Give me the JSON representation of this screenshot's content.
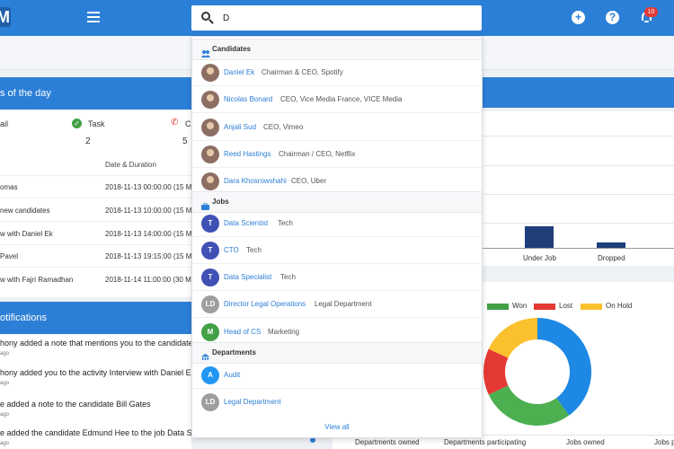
{
  "app": {
    "logo_letter": "M",
    "notifications_count": "10"
  },
  "search": {
    "value": "D",
    "placeholder": ""
  },
  "dropdown": {
    "candidates_heading": "Candidates",
    "candidates": [
      {
        "name": "Daniel Ek",
        "title": "Chairman & CEO, Spotify"
      },
      {
        "name": "Nicolas Bonard",
        "title": "CEO, Vice Media France, VICE Media"
      },
      {
        "name": "Anjali Sud",
        "title": "CEO, Vimeo"
      },
      {
        "name": "Reed Hastings",
        "title": "Chairman / CEO, Netflix"
      },
      {
        "name": "Dara Khosrowshahi",
        "title": "CEO, Uber"
      }
    ],
    "jobs_heading": "Jobs",
    "jobs": [
      {
        "initials": "T",
        "name": "Data Scientist",
        "department": "Tech",
        "color": "#3f51b5"
      },
      {
        "initials": "T",
        "name": "CTO",
        "department": "Tech",
        "color": "#3f51b5"
      },
      {
        "initials": "T",
        "name": "Data Specialist",
        "department": "Tech",
        "color": "#3f51b5"
      },
      {
        "initials": "LD",
        "name": "Director Legal Operations",
        "department": "Legal Department",
        "color": "#9e9e9e"
      },
      {
        "initials": "M",
        "name": "Head of CS",
        "department": "Marketing",
        "color": "#43a047"
      }
    ],
    "departments_heading": "Departments",
    "departments": [
      {
        "initials": "A",
        "name": "Audit",
        "color": "#2196f3"
      },
      {
        "initials": "LD",
        "name": "Legal Department",
        "color": "#9e9e9e"
      }
    ],
    "view_all": "View all"
  },
  "activities": {
    "title": "s of the day",
    "stats": [
      {
        "label": "ail",
        "value": ""
      },
      {
        "label": "Task",
        "value": "2"
      },
      {
        "label": "C",
        "value": "5"
      }
    ],
    "col_date": "Date & Duration",
    "rows": [
      {
        "name": "omas",
        "date": "2018-11-13 00:00:00 (15 M"
      },
      {
        "name": "new candidates",
        "date": "2018-11-13 10:00:00 (15 M"
      },
      {
        "name": "w with Daniel Ek",
        "date": "2018-11-13 14:00:00 (15 M"
      },
      {
        "name": "Pavel",
        "date": "2018-11-13 19:15:00 (15 Mi"
      },
      {
        "name": "w with Fajri Ramadhan",
        "date": "2018-11-14 11:00:00 (30 M"
      }
    ]
  },
  "notifications": {
    "title": "otifications",
    "items": [
      {
        "text": "hony added a note that mentions you to the candidate",
        "ago": "ago"
      },
      {
        "text": "hony added you to the activity Interview with Daniel E",
        "ago": "ago"
      },
      {
        "text": "e added a note to the candidate Bill Gates",
        "ago": "ago"
      },
      {
        "text": "e added the candidate Edmund Hee to the job Data S",
        "ago": "ago"
      }
    ]
  },
  "right_panel": {
    "bar_labels": [
      "Under Job",
      "Dropped"
    ],
    "bar_values": [
      24,
      6
    ],
    "legend": [
      {
        "label": "Won",
        "color": "#43a047"
      },
      {
        "label": "Lost",
        "color": "#e53935"
      },
      {
        "label": "On Hold",
        "color": "#fbc02d"
      }
    ],
    "chart_colors": [
      "#1e88e5",
      "#4caf50",
      "#e53935",
      "#fbc02d"
    ],
    "donut_values": [
      40,
      28,
      14,
      18
    ]
  },
  "footer": {
    "columns": [
      "Departments owned",
      "Departments participating",
      "Jobs owned",
      "Jobs p"
    ]
  }
}
